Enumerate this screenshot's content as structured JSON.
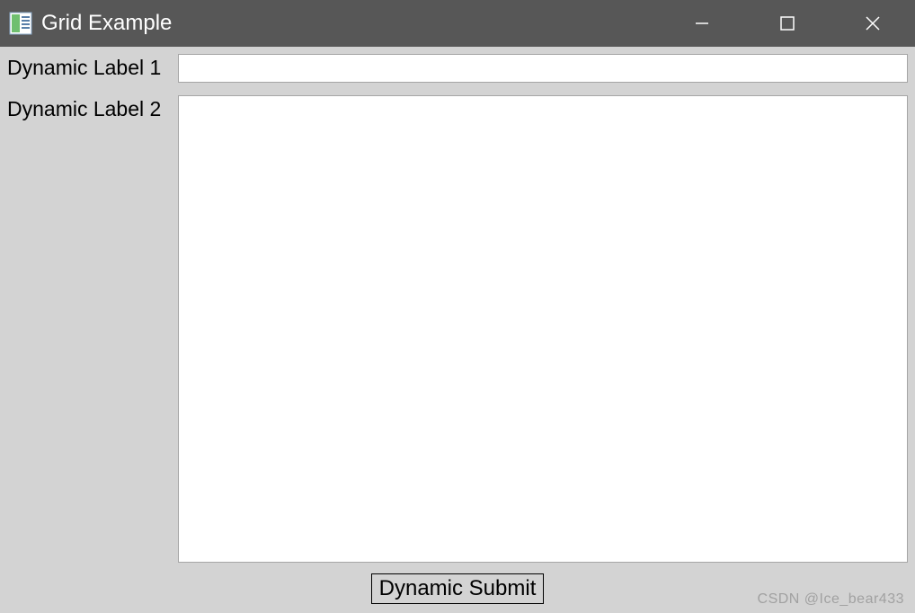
{
  "window": {
    "title": "Grid Example"
  },
  "form": {
    "rows": [
      {
        "label": "Dynamic Label 1",
        "value": ""
      },
      {
        "label": "Dynamic Label 2",
        "value": ""
      }
    ],
    "submit_label": "Dynamic Submit"
  },
  "watermark": "CSDN @Ice_bear433"
}
